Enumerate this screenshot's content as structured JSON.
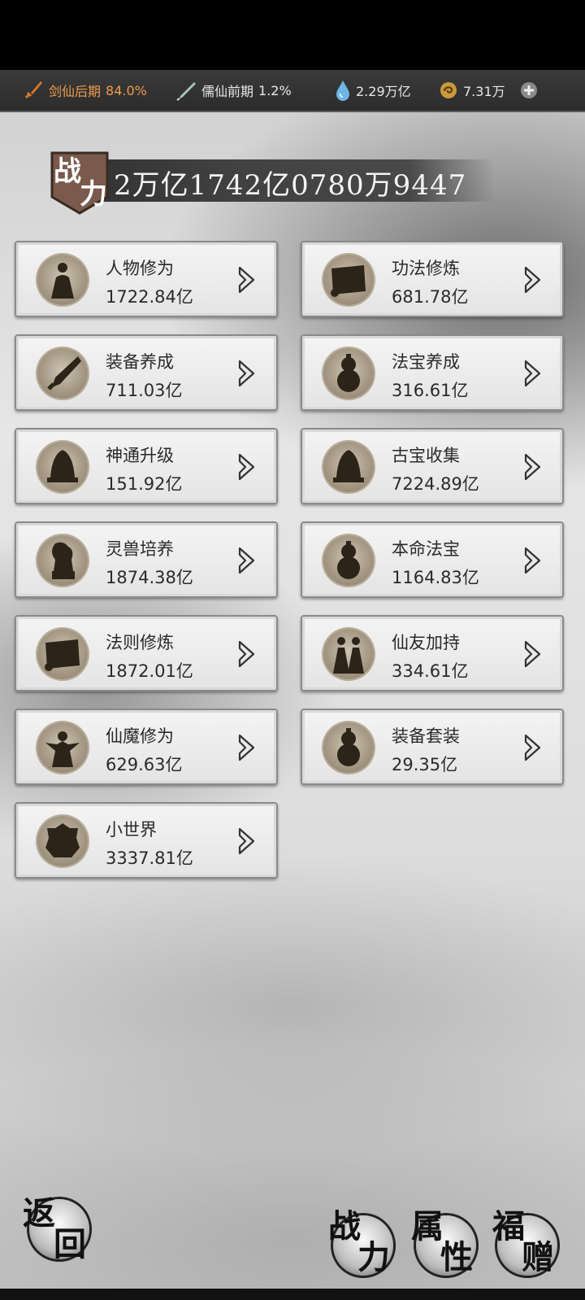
{
  "topbar": {
    "realm1": {
      "label": "剑仙后期",
      "percent": "84.0%"
    },
    "realm2": {
      "label": "儒仙前期",
      "percent": "1.2%"
    },
    "spirit": "2.29万亿",
    "gold": "7.31万"
  },
  "power": {
    "label_a": "战",
    "label_b": "力",
    "value": "2万亿1742亿0780万9447"
  },
  "cards": [
    {
      "name": "人物修为",
      "value": "1722.84亿",
      "icon": "figure-icon"
    },
    {
      "name": "功法修炼",
      "value": "681.78亿",
      "icon": "scroll-icon"
    },
    {
      "name": "装备养成",
      "value": "711.03亿",
      "icon": "weapon-icon"
    },
    {
      "name": "法宝养成",
      "value": "316.61亿",
      "icon": "gourd-icon"
    },
    {
      "name": "神通升级",
      "value": "151.92亿",
      "icon": "bell-icon"
    },
    {
      "name": "古宝收集",
      "value": "7224.89亿",
      "icon": "bell-icon"
    },
    {
      "name": "灵兽培养",
      "value": "1874.38亿",
      "icon": "beast-icon"
    },
    {
      "name": "本命法宝",
      "value": "1164.83亿",
      "icon": "gourd-icon"
    },
    {
      "name": "法则修炼",
      "value": "1872.01亿",
      "icon": "scroll-icon"
    },
    {
      "name": "仙友加持",
      "value": "334.61亿",
      "icon": "companions-icon"
    },
    {
      "name": "仙魔修为",
      "value": "629.63亿",
      "icon": "demon-icon"
    },
    {
      "name": "装备套装",
      "value": "29.35亿",
      "icon": "gourd-icon"
    },
    {
      "name": "小世界",
      "value": "3337.81亿",
      "icon": "world-icon"
    }
  ],
  "bottom": {
    "back": [
      "返",
      "回"
    ],
    "power": [
      "战",
      "力"
    ],
    "attrs": [
      "属",
      "性"
    ],
    "gift": [
      "福",
      "赠"
    ]
  }
}
